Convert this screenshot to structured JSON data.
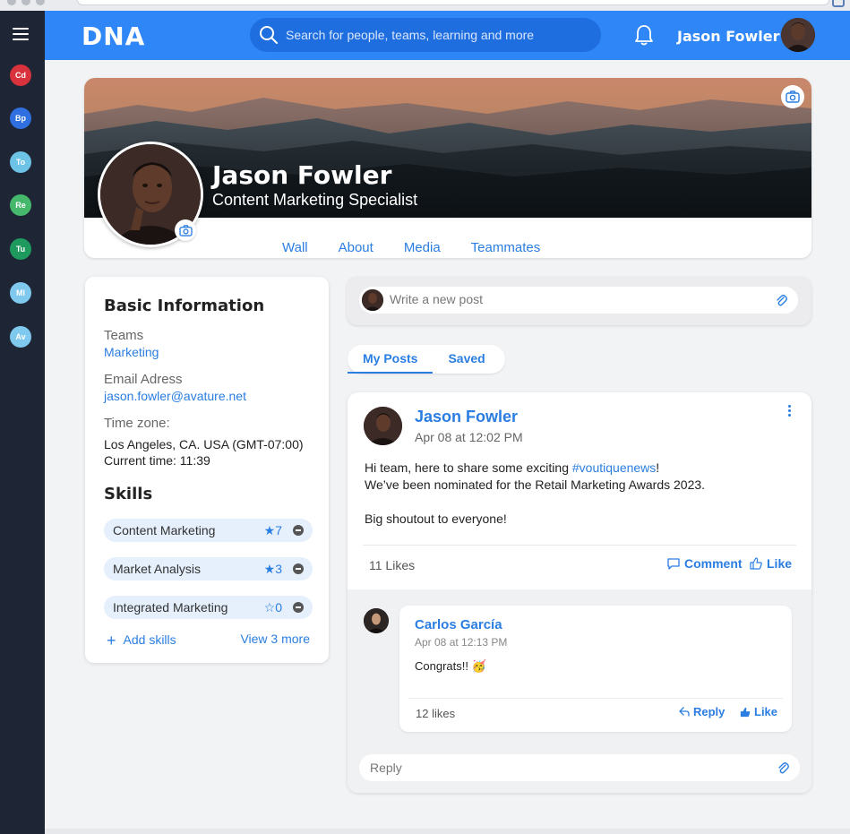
{
  "app": {
    "logo": "DNA",
    "search_placeholder": "Search for people, teams, learning and more",
    "user_name": "Jason Fowler"
  },
  "sidebar": {
    "apps": [
      {
        "label": "Cd",
        "color": "#d8323c"
      },
      {
        "label": "Bp",
        "color": "#2f6fe0"
      },
      {
        "label": "To",
        "color": "#6cc3e6"
      },
      {
        "label": "Re",
        "color": "#45b86b"
      },
      {
        "label": "Tu",
        "color": "#1f9a5f"
      },
      {
        "label": "Ml",
        "color": "#7fc8ee"
      },
      {
        "label": "Av",
        "color": "#7fc8ee"
      }
    ]
  },
  "profile": {
    "name": "Jason Fowler",
    "role": "Content Marketing Specialist",
    "tabs": [
      "Wall",
      "About",
      "Media",
      "Teammates"
    ],
    "active_tab": "Wall"
  },
  "basic_info": {
    "title": "Basic Information",
    "teams_label": "Teams",
    "teams_value": "Marketing",
    "email_label": "Email Adress",
    "email_value": "jason.fowler@avature.net",
    "timezone_label": "Time zone:",
    "timezone_value": "Los Angeles, CA. USA  (GMT-07:00)",
    "current_time": "Current time: 11:39"
  },
  "skills": {
    "title": "Skills",
    "items": [
      {
        "name": "Content Marketing",
        "count": "★7"
      },
      {
        "name": "Market Analysis",
        "count": "★3"
      },
      {
        "name": "Integrated Marketing",
        "count": "☆0"
      }
    ],
    "add_label": "Add skills",
    "view_more_label": "View 3 more"
  },
  "composer": {
    "placeholder": "Write a new post"
  },
  "post_tabs": [
    "My Posts",
    "Saved"
  ],
  "post": {
    "author": "Jason Fowler",
    "time": "Apr 08 at 12:02 PM",
    "line1_prefix": "Hi team, here to share some exciting ",
    "hashtag": "#voutiquenews",
    "line1_suffix": "!",
    "line2": "We’ve been nominated for the Retail Marketing Awards 2023.",
    "line3": "Big shoutout to everyone!",
    "likes": "11 Likes",
    "comment_label": "Comment",
    "like_label": "Like"
  },
  "comment": {
    "author": "Carlos García",
    "time": "Apr 08 at 12:13 PM",
    "text": "Congrats!! 🥳",
    "likes": "12 likes",
    "reply_label": "Reply",
    "like_label": "Like"
  },
  "reply_box": {
    "placeholder": "Reply"
  },
  "colors": {
    "accent": "#2f86f6",
    "link": "#2a7de1",
    "sidebar": "#1e2535"
  }
}
